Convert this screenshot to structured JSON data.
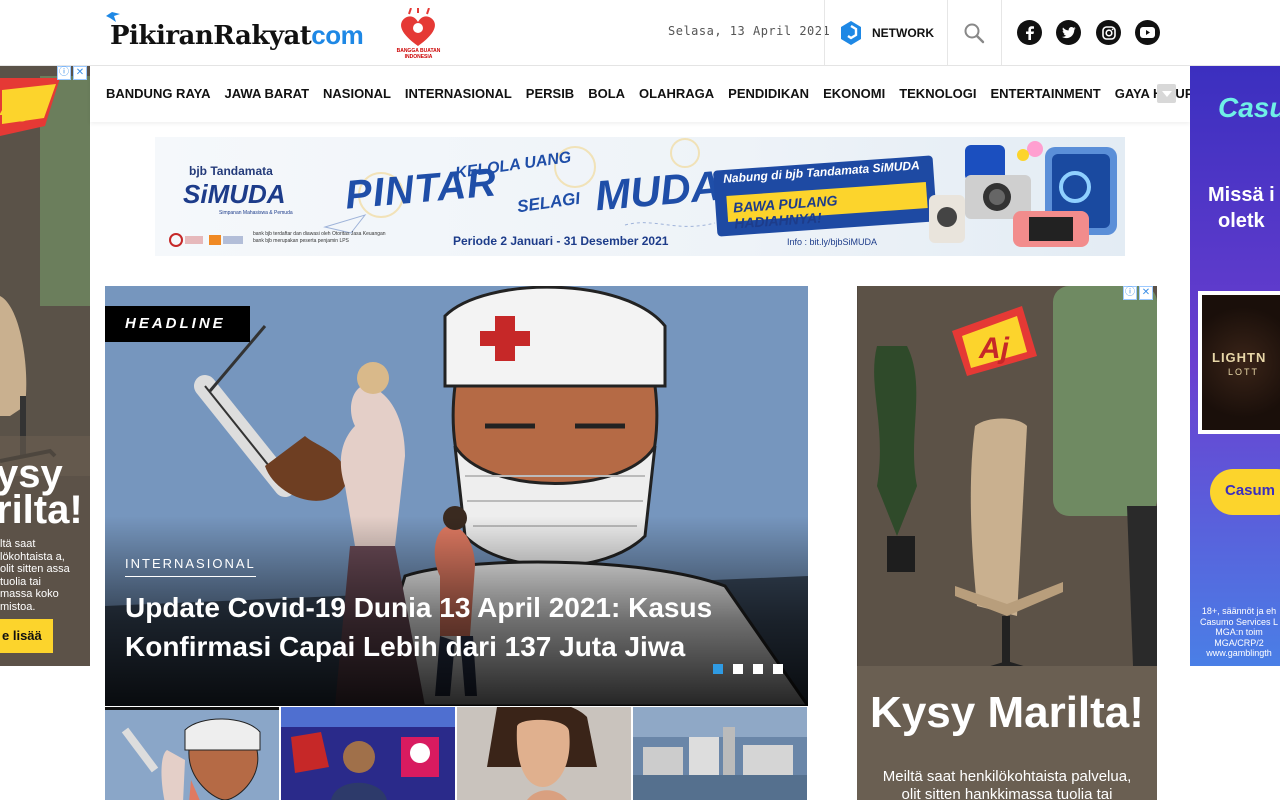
{
  "header": {
    "logo_main": "PikiranRakyat",
    "logo_com": "com",
    "badge_text": "BANGGA BUATAN INDONESIA",
    "date": "Selasa, 13 April 2021",
    "network_label": "NETWORK",
    "social": [
      "facebook-icon",
      "twitter-icon",
      "instagram-icon",
      "youtube-icon"
    ]
  },
  "nav": {
    "items": [
      "BANDUNG RAYA",
      "JAWA BARAT",
      "NASIONAL",
      "INTERNASIONAL",
      "PERSIB",
      "BOLA",
      "OLAHRAGA",
      "PENDIDIKAN",
      "EKONOMI",
      "TEKNOLOGI",
      "ENTERTAINMENT",
      "GAYA HIDUP"
    ]
  },
  "banner": {
    "bjb": "bjb Tandamata",
    "simuda": "SiMUDA",
    "simuda_sub": "Simpanan Mahasiswa & Pemuda",
    "pintar": "PINTAR",
    "kelola": "KELOLA UANG",
    "selagi": "SELAGI",
    "muda": "MUDA",
    "nabung": "Nabung di bjb Tandamata SiMUDA",
    "bawa": "BAWA PULANG HADIAHNYA!",
    "periode": "Periode 2 Januari - 31 Desember 2021",
    "info": "Info : bit.ly/bjbSiMUDA",
    "legal_1": "bank bjb terdaftar dan diawasi oleh Otoritas Jasa Keuangan",
    "legal_2": "bank bjb merupakan peserta penjamin LPS"
  },
  "headline": {
    "tag": "HEADLINE",
    "category": "INTERNASIONAL",
    "title": "Update Covid-19 Dunia 13 April 2021: Kasus Konfirmasi Capai Lebih dari 137 Juta Jiwa",
    "slides": 4,
    "active_slide": 1
  },
  "left_ad": {
    "logo": "Aj",
    "title_1": "ysy",
    "title_2": "rilta!",
    "body": "ltä saat lökohtaista a, olit sitten assa tuolia tai massa koko mistoa.",
    "cta": "e lisää"
  },
  "right_side_ad": {
    "brand": "Casu",
    "headline_1": "Missä i",
    "headline_2": "oletk",
    "cta": "Casum",
    "logo_text": "LIGHTN",
    "logo_sub": "LOTT",
    "fine_print": "18+, säännöt ja eh Casumo Services L MGA:n toim MGA/CRP/2 www.gamblingth"
  },
  "right_ad": {
    "logo": "Aj",
    "title": "Kysy Marilta!",
    "body": "Meiltä saat henkilökohtaista palvelua, olit sitten hankkimassa tuolia tai kalustamassa koko"
  },
  "colors": {
    "accent_blue": "#1e88e5",
    "dot_active": "#2f9be3",
    "nav_text": "#111111",
    "headline_tag_bg": "#000000"
  }
}
